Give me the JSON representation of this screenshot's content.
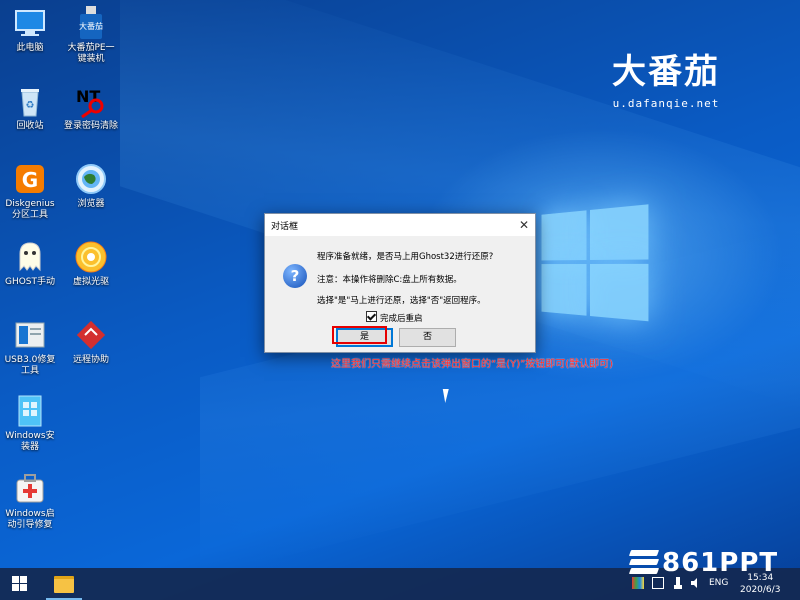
{
  "desktop": {
    "brand": {
      "logo": "大番茄",
      "url": "u.dafanqie.net"
    },
    "icons": [
      {
        "label": "此电脑",
        "icon": "computer-icon"
      },
      {
        "label": "大番茄PE一键装机",
        "icon": "usb-installer-icon",
        "badge": "大番茄"
      },
      {
        "label": "回收站",
        "icon": "recycle-bin-icon"
      },
      {
        "label": "登录密码清除",
        "icon": "nt-password-key-icon"
      },
      {
        "label": "Diskgenius分区工具",
        "icon": "diskgenius-icon"
      },
      {
        "label": "浏览器",
        "icon": "browser-globe-icon"
      },
      {
        "label": "GHOST手动",
        "icon": "ghost-icon"
      },
      {
        "label": "虚拟光驱",
        "icon": "cd-drive-icon"
      },
      {
        "label": "USB3.0修复工具",
        "icon": "usb-repair-icon"
      },
      {
        "label": "远程协助",
        "icon": "remote-assist-icon"
      },
      {
        "label": "Windows安装器",
        "icon": "windows-installer-icon"
      },
      {
        "label": "Windows启动引导修复",
        "icon": "boot-repair-icon"
      }
    ]
  },
  "dialog": {
    "title": "对话框",
    "line1": "程序准备就绪，是否马上用Ghost32进行还原?",
    "line2": "注意：本操作将删除C:盘上所有数据。",
    "line3": "选择\"是\"马上进行还原，选择\"否\"返回程序。",
    "checkbox_label": "完成后重启",
    "checkbox_checked": true,
    "yes_label": "是",
    "no_label": "否"
  },
  "annotation": "这里我们只需继续点击该弹出窗口的“是(Y)”按钮即可(默认即可)",
  "taskbar": {
    "lang": "ENG",
    "time": "15:34",
    "date": "2020/6/3"
  },
  "watermark": "861PPT",
  "colors": {
    "accent": "#0078d7",
    "annotation": "#ff2a2a",
    "highlight": "#e60000"
  }
}
